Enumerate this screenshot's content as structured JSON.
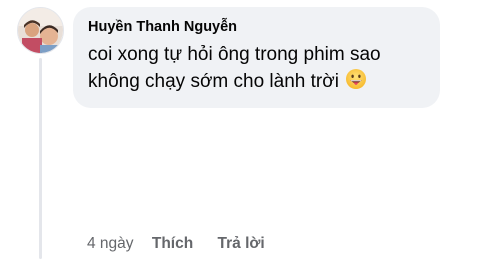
{
  "comment": {
    "author": "Huyền Thanh Nguyễn",
    "text": "coi xong tự hỏi ông trong phim sao không chạy sớm cho lành trời",
    "emoji": "grinning-tongue-emoji",
    "time": "4 ngày",
    "like_label": "Thích",
    "reply_label": "Trả lời"
  },
  "colors": {
    "bubble": "#f0f2f5",
    "text": "#050505",
    "meta": "#65676b",
    "thread_line": "#e4e6eb"
  }
}
